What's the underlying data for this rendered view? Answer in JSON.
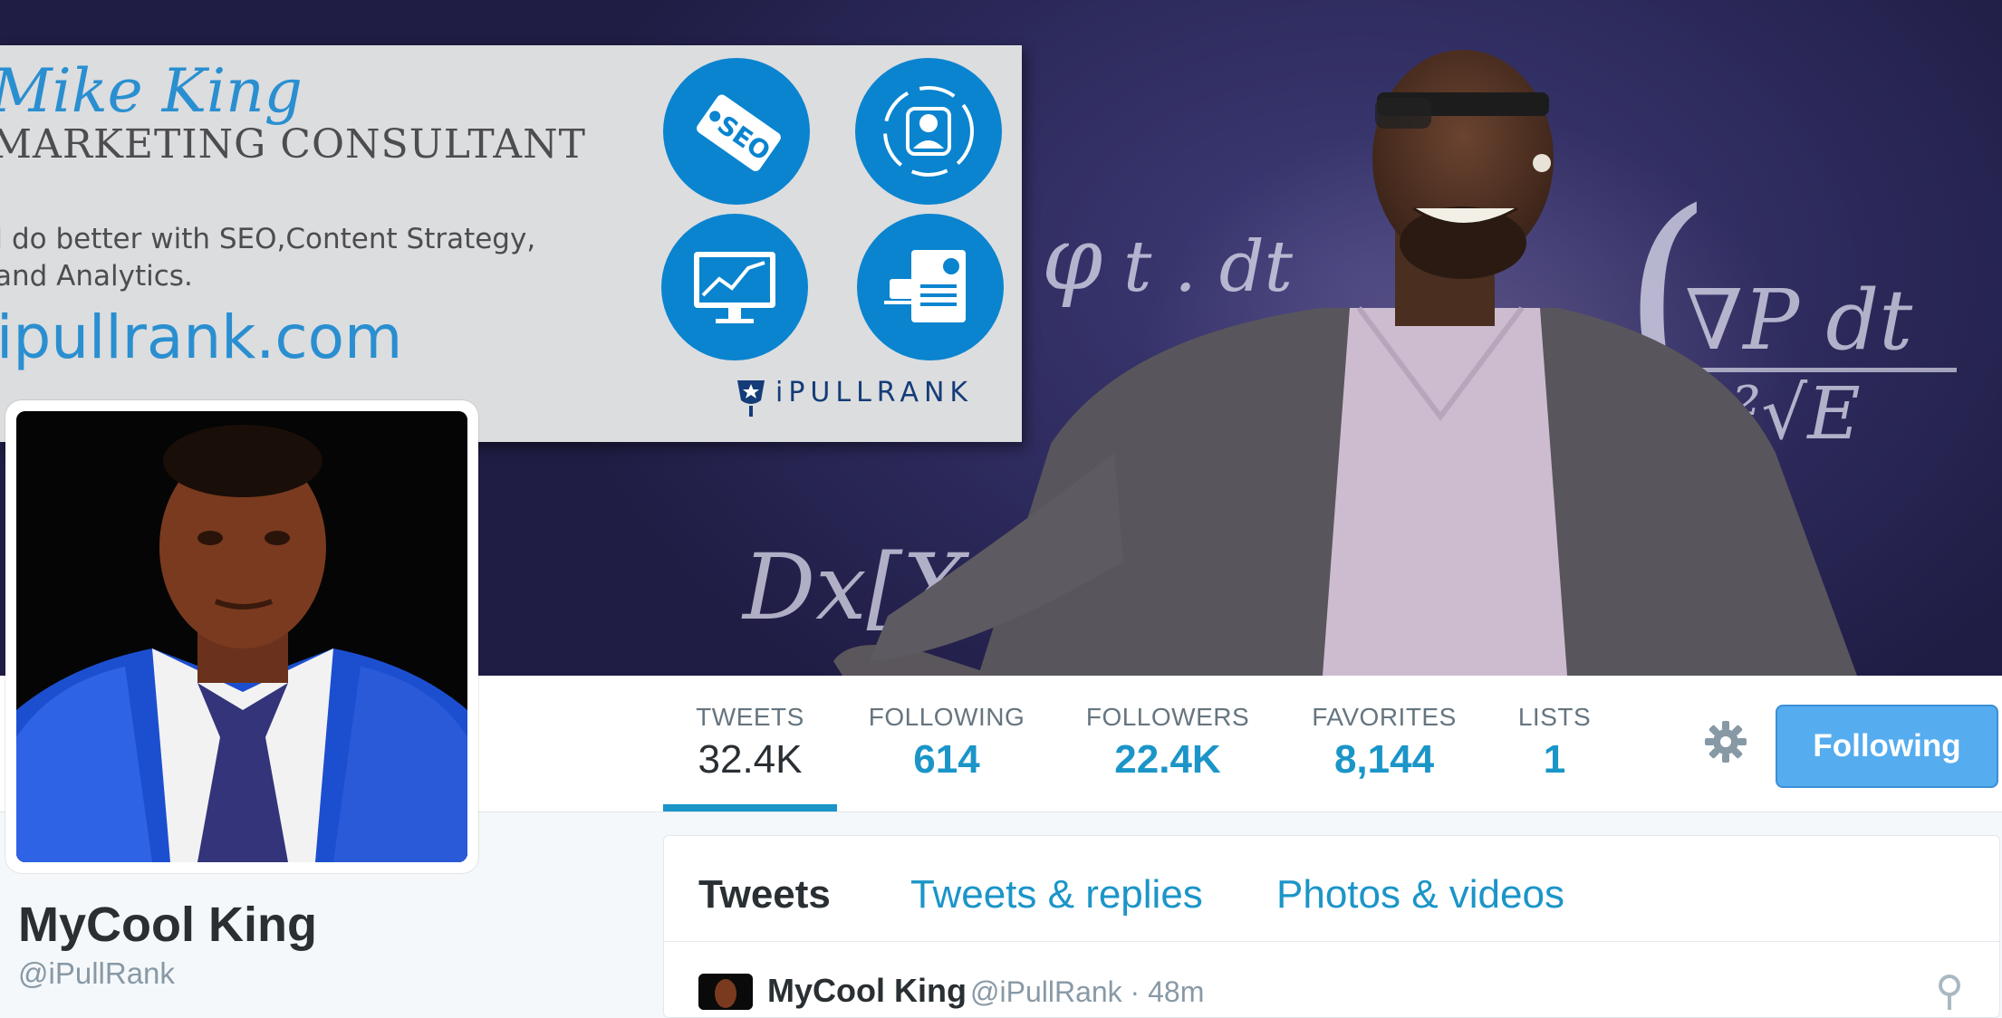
{
  "banner": {
    "card": {
      "name": "Mike King",
      "role": "MARKETING CONSULTANT",
      "desc_line1": "I do better with SEO,Content Strategy,",
      "desc_line2": "and Analytics.",
      "url": "ipullrank.com",
      "brand": "iPULLRANK",
      "icons": [
        "seo-tag-icon",
        "user-cycle-icon",
        "monitor-chart-icon",
        "report-coffee-icon"
      ],
      "badge_text": "SEO"
    }
  },
  "stats": [
    {
      "label": "TWEETS",
      "value": "32.4K",
      "active": true
    },
    {
      "label": "FOLLOWING",
      "value": "614"
    },
    {
      "label": "FOLLOWERS",
      "value": "22.4K"
    },
    {
      "label": "FAVORITES",
      "value": "8,144"
    },
    {
      "label": "LISTS",
      "value": "1"
    }
  ],
  "settings_icon": "gear-icon",
  "follow_button": "Following",
  "profile": {
    "name": "MyCool King",
    "handle": "@iPullRank"
  },
  "timeline": {
    "tabs": [
      {
        "label": "Tweets",
        "active": true
      },
      {
        "label": "Tweets & replies"
      },
      {
        "label": "Photos & videos"
      }
    ],
    "first_tweet": {
      "name": "MyCool King",
      "meta": "@iPullRank · 48m"
    }
  },
  "colors": {
    "accent": "#1b95c8",
    "button": "#55acee",
    "banner": "#2e2b5e",
    "card_circle": "#0a84cf"
  }
}
